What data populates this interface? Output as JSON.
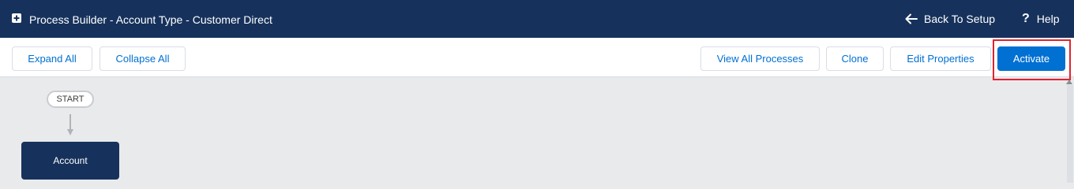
{
  "header": {
    "app_icon": "process-builder-icon",
    "title": "Process Builder - Account Type - Customer Direct",
    "back_label": "Back To Setup",
    "help_label": "Help"
  },
  "toolbar": {
    "expand_all": "Expand All",
    "collapse_all": "Collapse All",
    "view_all_processes": "View All Processes",
    "clone": "Clone",
    "edit_properties": "Edit Properties",
    "activate": "Activate"
  },
  "canvas": {
    "start_label": "START",
    "object_label": "Account"
  },
  "colors": {
    "header_bg": "#16325c",
    "primary": "#0070d2",
    "canvas_bg": "#e9eaec",
    "highlight": "#e0232e"
  }
}
